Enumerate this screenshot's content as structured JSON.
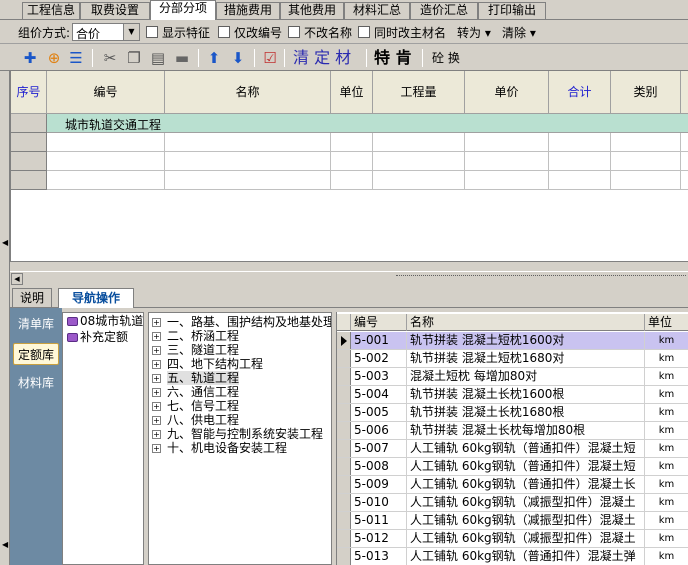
{
  "tabs": [
    "工程信息",
    "取费设置",
    "分部分项",
    "措施费用",
    "其他费用",
    "材料汇总",
    "造价汇总",
    "打印输出"
  ],
  "options": {
    "pricing_label": "组价方式:",
    "pricing_value": "合价",
    "show_features": "显示特征",
    "only_change_code": "仅改编号",
    "no_change_name": "不改名称",
    "sync_main_material": "同时改主材名",
    "convert": "转为",
    "clear": "清除"
  },
  "toolbar": {
    "qing_ding_cai": "清 定 材",
    "te_ken": "特 肯",
    "quan_huan": "砼 换"
  },
  "grid": {
    "columns": [
      "序号",
      "编号",
      "名称",
      "单位",
      "工程量",
      "单价",
      "合计",
      "类别"
    ],
    "project_row": "城市轨道交通工程"
  },
  "bottom_tabs": [
    "说明",
    "导航操作"
  ],
  "sidenav": [
    "清单库",
    "定额库",
    "材料库"
  ],
  "libraries": [
    "08城市轨道",
    "补充定额"
  ],
  "tree": [
    "一、路基、围护结构及地基处理",
    "二、桥涵工程",
    "三、隧道工程",
    "四、地下结构工程",
    "五、轨道工程",
    "六、通信工程",
    "七、信号工程",
    "八、供电工程",
    "九、智能与控制系统安装工程",
    "十、机电设备安装工程"
  ],
  "list": {
    "headers": [
      "编号",
      "名称",
      "单位"
    ],
    "rows": [
      {
        "code": "5-001",
        "name": "轨节拼装 混凝土短枕1600对",
        "unit": "km"
      },
      {
        "code": "5-002",
        "name": "轨节拼装 混凝土短枕1680对",
        "unit": "km"
      },
      {
        "code": "5-003",
        "name": "混凝土短枕 每增加80对",
        "unit": "km"
      },
      {
        "code": "5-004",
        "name": "轨节拼装 混凝土长枕1600根",
        "unit": "km"
      },
      {
        "code": "5-005",
        "name": "轨节拼装 混凝土长枕1680根",
        "unit": "km"
      },
      {
        "code": "5-006",
        "name": "轨节拼装 混凝土长枕每增加80根",
        "unit": "km"
      },
      {
        "code": "5-007",
        "name": "人工铺轨 60kg钢轨（普通扣件）混凝土短",
        "unit": "km"
      },
      {
        "code": "5-008",
        "name": "人工铺轨 60kg钢轨（普通扣件）混凝土短",
        "unit": "km"
      },
      {
        "code": "5-009",
        "name": "人工铺轨 60kg钢轨（普通扣件）混凝土长",
        "unit": "km"
      },
      {
        "code": "5-010",
        "name": "人工铺轨 60kg钢轨（减振型扣件）混凝土",
        "unit": "km"
      },
      {
        "code": "5-011",
        "name": "人工铺轨 60kg钢轨（减振型扣件）混凝土",
        "unit": "km"
      },
      {
        "code": "5-012",
        "name": "人工铺轨 60kg钢轨（减振型扣件）混凝土",
        "unit": "km"
      },
      {
        "code": "5-013",
        "name": "人工铺轨 60kg钢轨（普通扣件）混凝土弹",
        "unit": "km"
      }
    ]
  }
}
